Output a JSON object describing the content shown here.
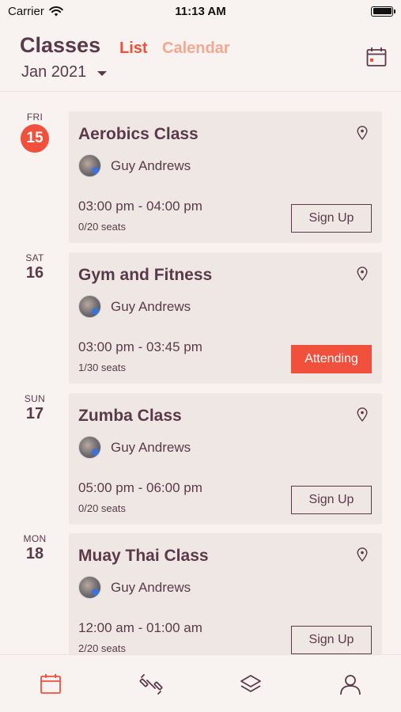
{
  "status": {
    "carrier": "Carrier",
    "time": "11:13 AM"
  },
  "header": {
    "title": "Classes",
    "tab_list": "List",
    "tab_calendar": "Calendar",
    "month": "Jan 2021",
    "calendar_icon": "calendar-icon"
  },
  "colors": {
    "accent": "#f0503c",
    "accent_light": "#f3a894",
    "text": "#5a3a4a",
    "card": "#efe7e4",
    "background": "#f8f3f1"
  },
  "days": [
    {
      "dow": "FRI",
      "day": "15",
      "today": true
    },
    {
      "dow": "SAT",
      "day": "16",
      "today": false
    },
    {
      "dow": "SUN",
      "day": "17",
      "today": false
    },
    {
      "dow": "MON",
      "day": "18",
      "today": false
    }
  ],
  "classes": [
    {
      "title": "Aerobics Class",
      "instructor": "Guy Andrews",
      "time": "03:00 pm - 04:00 pm",
      "seats": "0/20 seats",
      "button": "Sign Up",
      "status": "signup"
    },
    {
      "title": "Gym and Fitness",
      "instructor": "Guy Andrews",
      "time": "03:00 pm - 03:45 pm",
      "seats": "1/30 seats",
      "button": "Attending",
      "status": "attending"
    },
    {
      "title": "Zumba Class",
      "instructor": "Guy Andrews",
      "time": "05:00 pm - 06:00 pm",
      "seats": "0/20 seats",
      "button": "Sign Up",
      "status": "signup"
    },
    {
      "title": "Muay Thai Class",
      "instructor": "Guy Andrews",
      "time": "12:00 am - 01:00 am",
      "seats": "2/20 seats",
      "button": "Sign Up",
      "status": "signup"
    }
  ],
  "tabbar": {
    "items": [
      {
        "icon": "calendar-icon",
        "active": true
      },
      {
        "icon": "dumbbell-icon",
        "active": false
      },
      {
        "icon": "layers-icon",
        "active": false
      },
      {
        "icon": "profile-icon",
        "active": false
      }
    ]
  }
}
